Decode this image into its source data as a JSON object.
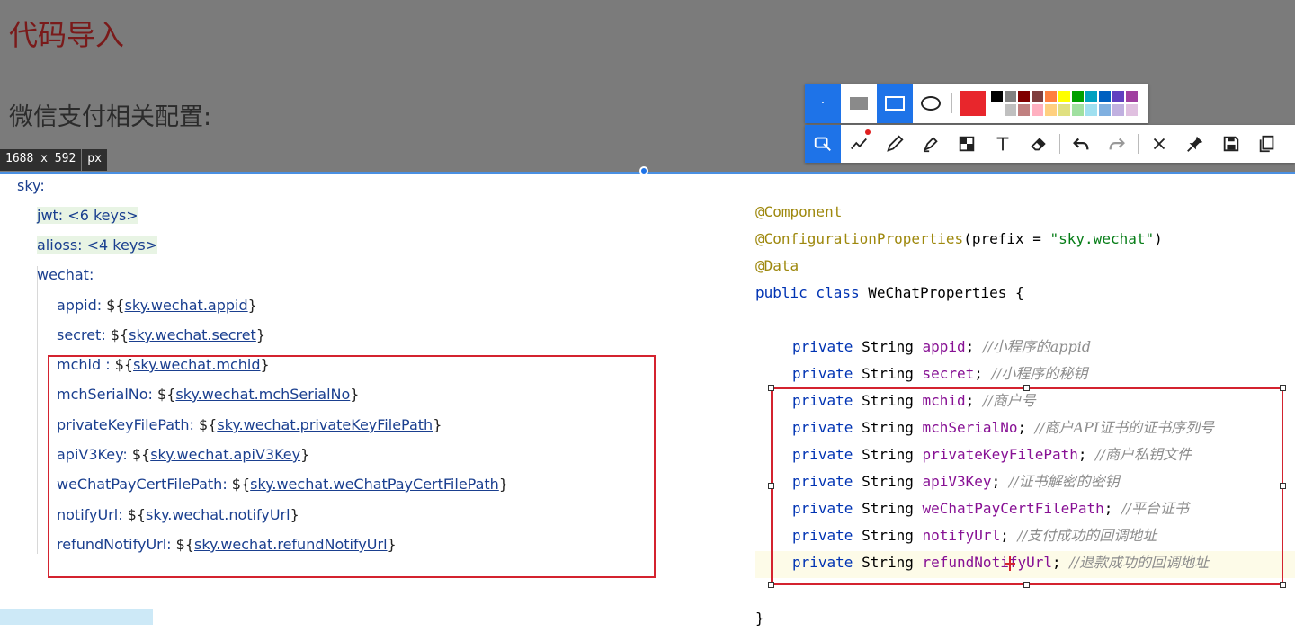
{
  "slide": {
    "title": "代码导入",
    "subtitle": "微信支付相关配置:"
  },
  "size_badge": {
    "dims": "1688 x 592",
    "unit": "px"
  },
  "toolbar_top": {
    "selected_color": "#e8262c",
    "palette": [
      "#000000",
      "#808080",
      "#800000",
      "#804040",
      "#ff8040",
      "#ffff00",
      "#00a000",
      "#00a0c0",
      "#0060c0",
      "#6040c0",
      "#a040a0",
      "#ffffff",
      "#c0c0c0",
      "#c08080",
      "#ffb0c0",
      "#ffd080",
      "#e0e080",
      "#a0e0a0",
      "#a0e0f0",
      "#80b0e0",
      "#c0b0e0",
      "#e0c0e0"
    ]
  },
  "yaml": {
    "lines": [
      {
        "indent": 0,
        "key": "sky:",
        "value": "",
        "ref": ""
      },
      {
        "indent": 1,
        "key": "jwt: <6 keys>",
        "value": "",
        "ref": "",
        "folded": true
      },
      {
        "indent": 1,
        "key": "alioss: <4 keys>",
        "value": "",
        "ref": "",
        "folded": true
      },
      {
        "indent": 1,
        "key": "wechat:",
        "value": "",
        "ref": ""
      },
      {
        "indent": 2,
        "key": "appid:",
        "ref": "sky.wechat.appid"
      },
      {
        "indent": 2,
        "key": "secret:",
        "ref": "sky.wechat.secret"
      },
      {
        "indent": 2,
        "key": "mchid :",
        "ref": "sky.wechat.mchid"
      },
      {
        "indent": 2,
        "key": "mchSerialNo:",
        "ref": "sky.wechat.mchSerialNo"
      },
      {
        "indent": 2,
        "key": "privateKeyFilePath:",
        "ref": "sky.wechat.privateKeyFilePath"
      },
      {
        "indent": 2,
        "key": "apiV3Key:",
        "ref": "sky.wechat.apiV3Key"
      },
      {
        "indent": 2,
        "key": "weChatPayCertFilePath:",
        "ref": "sky.wechat.weChatPayCertFilePath"
      },
      {
        "indent": 2,
        "key": "notifyUrl:",
        "ref": "sky.wechat.notifyUrl"
      },
      {
        "indent": 2,
        "key": "refundNotifyUrl:",
        "ref": "sky.wechat.refundNotifyUrl"
      }
    ]
  },
  "java": {
    "ann1": "@Component",
    "ann2": "@ConfigurationProperties",
    "ann2_args": "(prefix = ",
    "ann2_str": "\"sky.wechat\"",
    "ann2_end": ")",
    "ann3": "@Data",
    "class_kw": "public class ",
    "class_name": "WeChatProperties {",
    "closing": "}",
    "fields": [
      {
        "name": "appid",
        "comment": "//小程序的appid"
      },
      {
        "name": "secret",
        "comment": "//小程序的秘钥"
      },
      {
        "name": "mchid",
        "comment": "//商户号"
      },
      {
        "name": "mchSerialNo",
        "comment": "//商户API证书的证书序列号"
      },
      {
        "name": "privateKeyFilePath",
        "comment": "//商户私钥文件"
      },
      {
        "name": "apiV3Key",
        "comment": "//证书解密的密钥"
      },
      {
        "name": "weChatPayCertFilePath",
        "comment": "//平台证书"
      },
      {
        "name": "notifyUrl",
        "comment": "//支付成功的回调地址"
      },
      {
        "name": "refundNotifyUrl",
        "comment": "//退款成功的回调地址"
      }
    ],
    "private_kw": "private ",
    "type": "String "
  }
}
